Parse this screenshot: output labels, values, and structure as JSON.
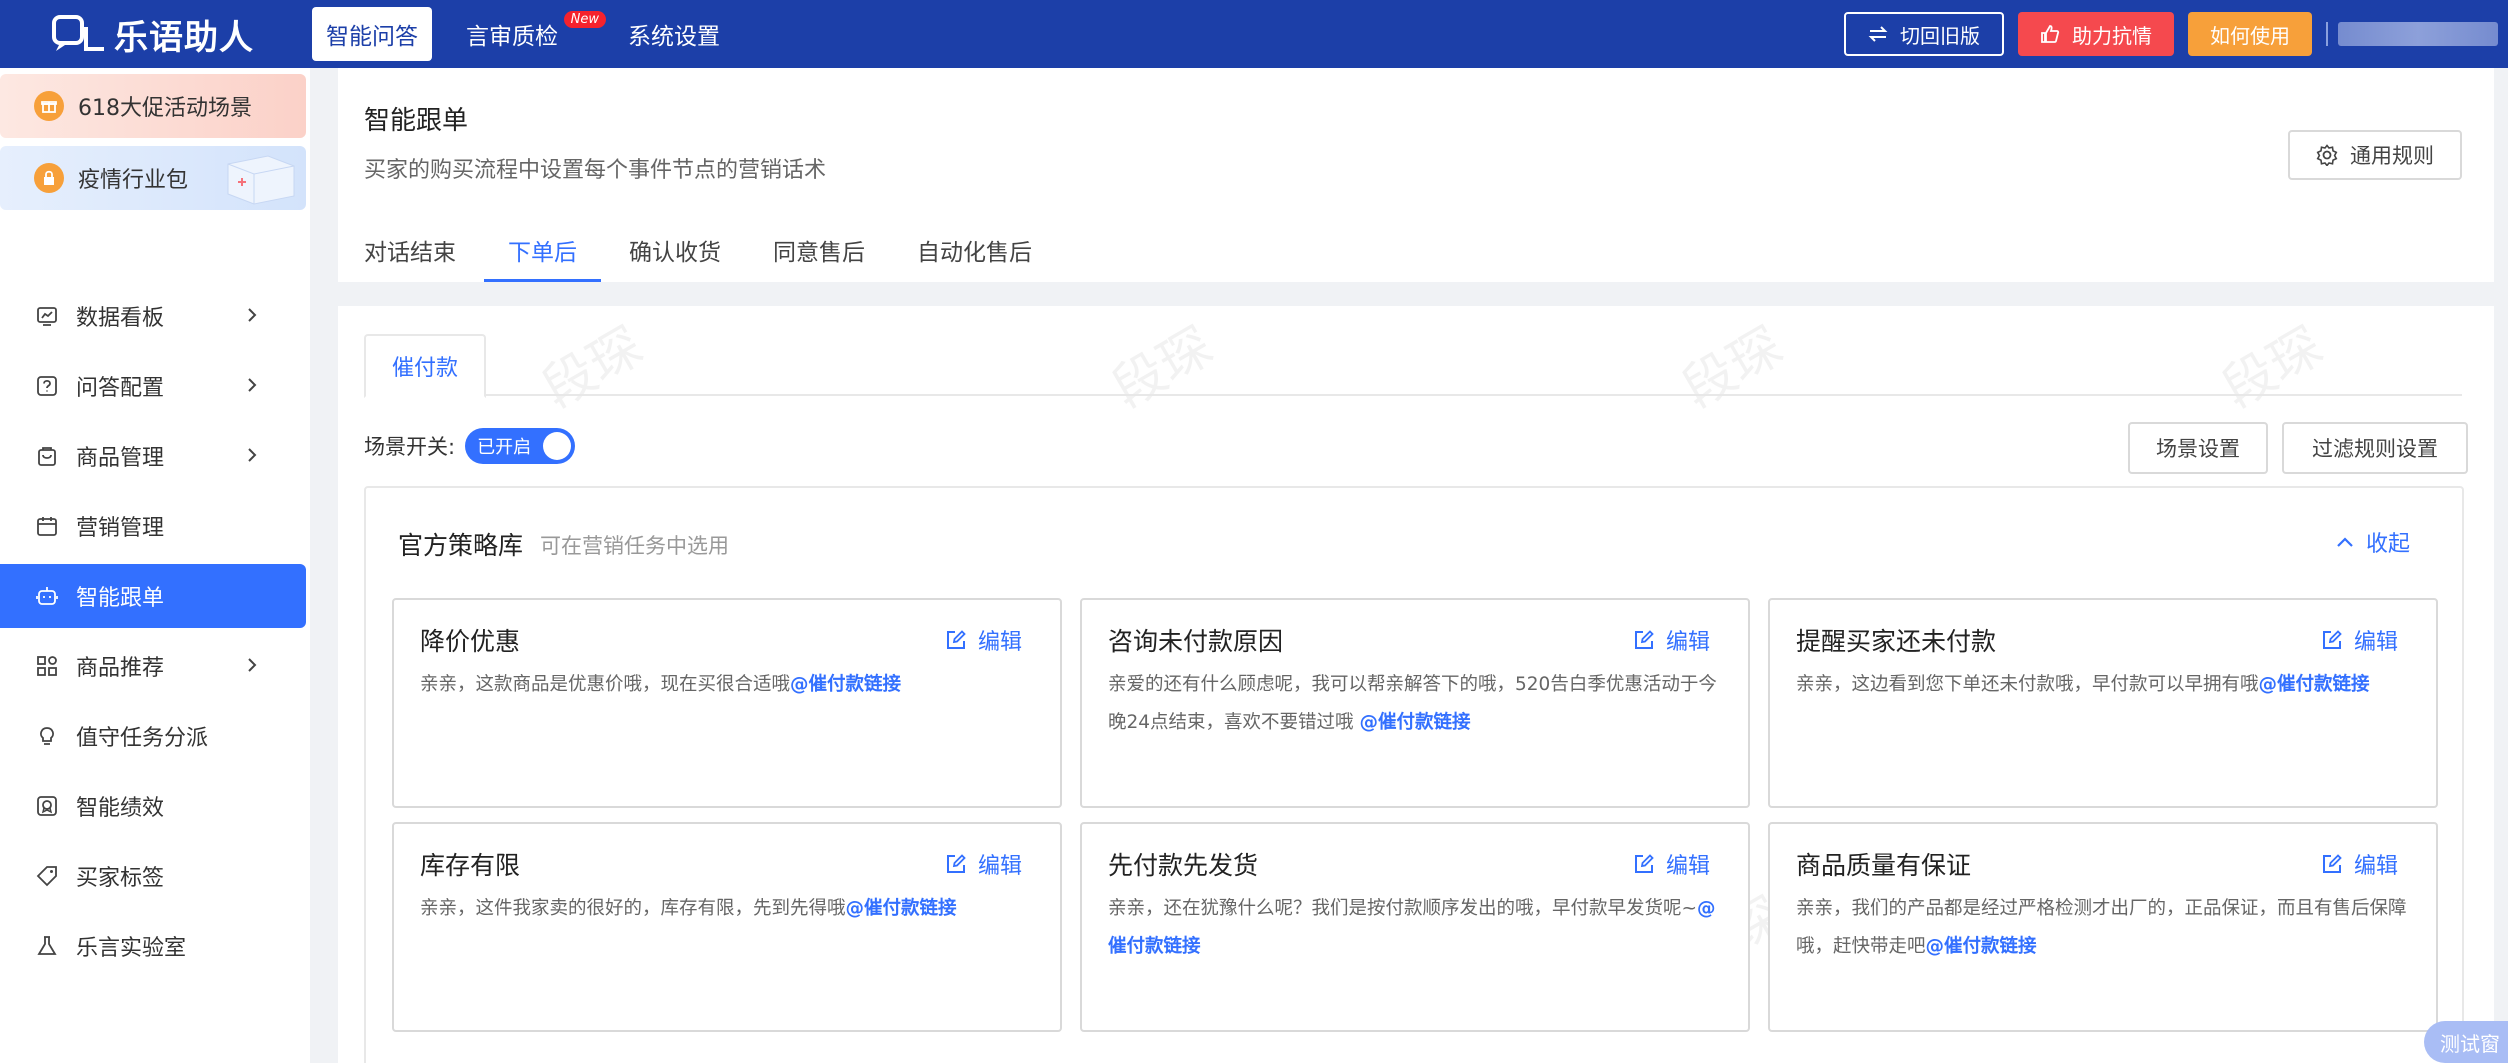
{
  "app": {
    "logo_text": "乐语助人"
  },
  "topnav": [
    {
      "label": "智能问答",
      "active": true
    },
    {
      "label": "言审质检",
      "badge": "New"
    },
    {
      "label": "系统设置"
    }
  ],
  "topright": {
    "switch_old": "切回旧版",
    "support": "助力抗情",
    "how_to_use": "如何使用"
  },
  "sidebar": {
    "promos": [
      {
        "label": "618大促活动场景"
      },
      {
        "label": "疫情行业包"
      }
    ],
    "items": [
      {
        "label": "数据看板",
        "icon": "chart-icon",
        "chevron": true
      },
      {
        "label": "问答配置",
        "icon": "question-icon",
        "chevron": true
      },
      {
        "label": "商品管理",
        "icon": "bag-icon",
        "chevron": true
      },
      {
        "label": "营销管理",
        "icon": "calendar-icon",
        "chevron": false
      },
      {
        "label": "智能跟单",
        "icon": "robot-icon",
        "chevron": false,
        "active": true
      },
      {
        "label": "商品推荐",
        "icon": "grid-icon",
        "chevron": true
      },
      {
        "label": "值守任务分派",
        "icon": "bulb-icon",
        "chevron": false
      },
      {
        "label": "智能绩效",
        "icon": "medal-icon",
        "chevron": false
      },
      {
        "label": "买家标签",
        "icon": "tag-icon",
        "chevron": false
      },
      {
        "label": "乐言实验室",
        "icon": "flask-icon",
        "chevron": false
      }
    ]
  },
  "header": {
    "title": "智能跟单",
    "subtitle": "买家的购买流程中设置每个事件节点的营销话术",
    "rule_button": "通用规则",
    "tabs": [
      {
        "label": "对话结束"
      },
      {
        "label": "下单后",
        "active": true
      },
      {
        "label": "确认收货"
      },
      {
        "label": "同意售后"
      },
      {
        "label": "自动化售后"
      }
    ]
  },
  "content": {
    "subtab": "催付款",
    "switch_label": "场景开关:",
    "switch_state": "已开启",
    "scene_settings": "场景设置",
    "filter_settings": "过滤规则设置",
    "library": {
      "title": "官方策略库",
      "subtitle": "可在营销任务中选用",
      "collapse": "收起",
      "edit_label": "编辑",
      "cards": [
        {
          "title": "降价优惠",
          "text": "亲亲，这款商品是优惠价哦，现在买很合适哦",
          "link": "@催付款链接"
        },
        {
          "title": "咨询未付款原因",
          "text": "亲爱的还有什么顾虑呢，我可以帮亲解答下的哦，520告白季优惠活动于今晚24点结束，喜欢不要错过哦 ",
          "link": "@催付款链接"
        },
        {
          "title": "提醒买家还未付款",
          "text": "亲亲，这边看到您下单还未付款哦，早付款可以早拥有哦",
          "link": "@催付款链接"
        },
        {
          "title": "库存有限",
          "text": "亲亲，这件我家卖的很好的，库存有限，先到先得哦",
          "link": "@催付款链接"
        },
        {
          "title": "先付款先发货",
          "text": "亲亲，还在犹豫什么呢？我们是按付款顺序发出的哦，早付款早发货呢~",
          "link": "@催付款链接"
        },
        {
          "title": "商品质量有保证",
          "text": "亲亲，我们的产品都是经过严格检测才出厂的，正品保证，而且有售后保障哦，赶快带走吧",
          "link": "@催付款链接"
        }
      ]
    }
  },
  "watermark": "段琛",
  "test_badge": "测试窗",
  "colors": {
    "primary": "#3370ff",
    "topbar": "#1c3fa8",
    "red_button": "#f5494e",
    "orange_button": "#f7a03a"
  }
}
